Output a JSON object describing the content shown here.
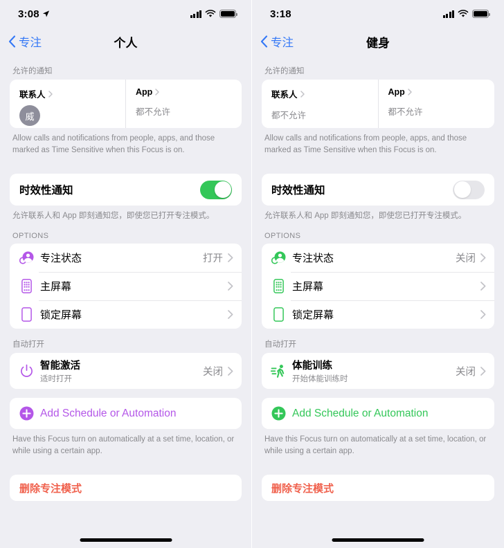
{
  "theme": {
    "page_bg": "#eeeef3",
    "card_bg": "#ffffff",
    "tint_blue": "#3478f6",
    "toggle_on": "#34c759",
    "toggle_off": "#e6e6ea",
    "destructive_red": "#f0614d",
    "muted_text": "#8a8a8e",
    "avatar_bg": "#8e8e9b"
  },
  "screens": [
    {
      "id": "personal-focus",
      "accent": "#b457e8",
      "status_bar": {
        "time": "3:08",
        "location_icon": "location-arrow-icon",
        "signal_icon": "cellular-signal-icon",
        "wifi_icon": "wifi-icon",
        "battery_icon": "battery-full-icon"
      },
      "nav": {
        "back_icon": "chevron-left-icon",
        "back_label": "专注",
        "title": "个人"
      },
      "allowed": {
        "header": "允许的通知",
        "contacts": {
          "title": "联系人",
          "chevron_icon": "chevron-right-icon",
          "avatar_initial": "威",
          "value": ""
        },
        "apps": {
          "title": "App",
          "chevron_icon": "chevron-right-icon",
          "value": "都不允许"
        },
        "footnote": "Allow calls and notifications from people, apps, and those marked as Time Sensitive when this Focus is on."
      },
      "time_sensitive": {
        "label": "时效性通知",
        "enabled": true,
        "footnote": "允许联系人和 App 即刻通知您，即使您已打开专注模式。"
      },
      "options": {
        "header": "OPTIONS",
        "rows": [
          {
            "icon": "focus-status-icon",
            "title": "专注状态",
            "value": "打开",
            "chevron_icon": "chevron-right-icon"
          },
          {
            "icon": "home-screen-icon",
            "title": "主屏幕",
            "value": "",
            "chevron_icon": "chevron-right-icon"
          },
          {
            "icon": "lock-screen-icon",
            "title": "锁定屏幕",
            "value": "",
            "chevron_icon": "chevron-right-icon"
          }
        ]
      },
      "automation": {
        "header": "自动打开",
        "row": {
          "icon": "power-icon",
          "title": "智能激活",
          "subtitle": "适时打开",
          "value": "关闭",
          "chevron_icon": "chevron-right-icon"
        },
        "add_label": "Add Schedule or Automation",
        "add_icon": "plus-circle-icon",
        "footnote": "Have this Focus turn on automatically at a set time, location, or while using a certain app."
      },
      "delete_label": "删除专注模式"
    },
    {
      "id": "fitness-focus",
      "accent": "#34c759",
      "status_bar": {
        "time": "3:18",
        "location_icon": "",
        "signal_icon": "cellular-signal-icon",
        "wifi_icon": "wifi-icon",
        "battery_icon": "battery-full-icon"
      },
      "nav": {
        "back_icon": "chevron-left-icon",
        "back_label": "专注",
        "title": "健身"
      },
      "allowed": {
        "header": "允许的通知",
        "contacts": {
          "title": "联系人",
          "chevron_icon": "chevron-right-icon",
          "avatar_initial": "",
          "value": "都不允许"
        },
        "apps": {
          "title": "App",
          "chevron_icon": "chevron-right-icon",
          "value": "都不允许"
        },
        "footnote": "Allow calls and notifications from people, apps, and those marked as Time Sensitive when this Focus is on."
      },
      "time_sensitive": {
        "label": "时效性通知",
        "enabled": false,
        "footnote": "允许联系人和 App 即刻通知您，即使您已打开专注模式。"
      },
      "options": {
        "header": "OPTIONS",
        "rows": [
          {
            "icon": "focus-status-icon",
            "title": "专注状态",
            "value": "关闭",
            "chevron_icon": "chevron-right-icon"
          },
          {
            "icon": "home-screen-icon",
            "title": "主屏幕",
            "value": "",
            "chevron_icon": "chevron-right-icon"
          },
          {
            "icon": "lock-screen-icon",
            "title": "锁定屏幕",
            "value": "",
            "chevron_icon": "chevron-right-icon"
          }
        ]
      },
      "automation": {
        "header": "自动打开",
        "row": {
          "icon": "workout-running-icon",
          "title": "体能训练",
          "subtitle": "开始体能训练时",
          "value": "关闭",
          "chevron_icon": "chevron-right-icon"
        },
        "add_label": "Add Schedule or Automation",
        "add_icon": "plus-circle-icon",
        "footnote": "Have this Focus turn on automatically at a set time, location, or while using a certain app."
      },
      "delete_label": "删除专注模式"
    }
  ]
}
